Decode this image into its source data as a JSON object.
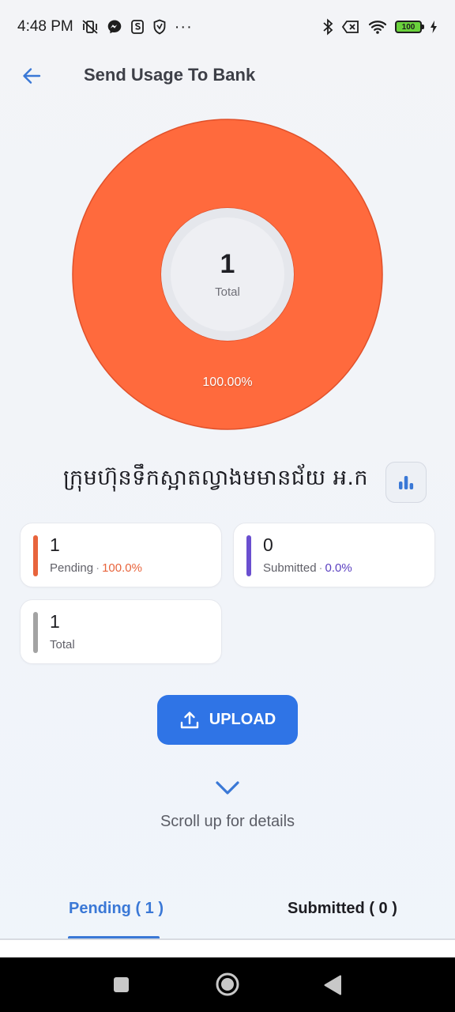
{
  "status_bar": {
    "time": "4:48 PM",
    "more": "···",
    "battery_level": "100"
  },
  "app_bar": {
    "title": "Send Usage To Bank",
    "back_icon": "arrow-left-icon"
  },
  "chart_data": {
    "type": "pie",
    "variant": "donut",
    "categories": [
      "Pending",
      "Submitted"
    ],
    "values": [
      1,
      0
    ],
    "colors": [
      "#ff6a3d",
      "#6a4fd0"
    ],
    "center_value": "1",
    "center_label": "Total",
    "slice_labels": [
      "100.00%"
    ]
  },
  "company": {
    "name": "ក្រុមហ៊ុនទឹកស្អាតល្វាងមមានជ័យ អ.ក",
    "chart_toggle_icon": "bar-chart-icon"
  },
  "stats": {
    "pending": {
      "value": "1",
      "label": "Pending",
      "percent": "100.0%",
      "color": "#e8643c"
    },
    "submitted": {
      "value": "0",
      "label": "Submitted",
      "percent": "0.0%",
      "color": "#6a4fd0"
    },
    "total": {
      "value": "1",
      "label": "Total",
      "color": "#a3a3a3"
    },
    "separator": "·"
  },
  "upload": {
    "label": "UPLOAD",
    "icon": "upload-icon",
    "color": "#2f74e6"
  },
  "scroll_hint": {
    "text": "Scroll up for details",
    "icon": "chevron-down-icon"
  },
  "tabs": [
    {
      "label": "Pending ( 1 )",
      "active": true
    },
    {
      "label": "Submitted ( 0 )",
      "active": false
    }
  ],
  "nav_bar": {
    "recents_icon": "square-icon",
    "home_icon": "circle-home-icon",
    "back_icon": "triangle-back-icon"
  }
}
